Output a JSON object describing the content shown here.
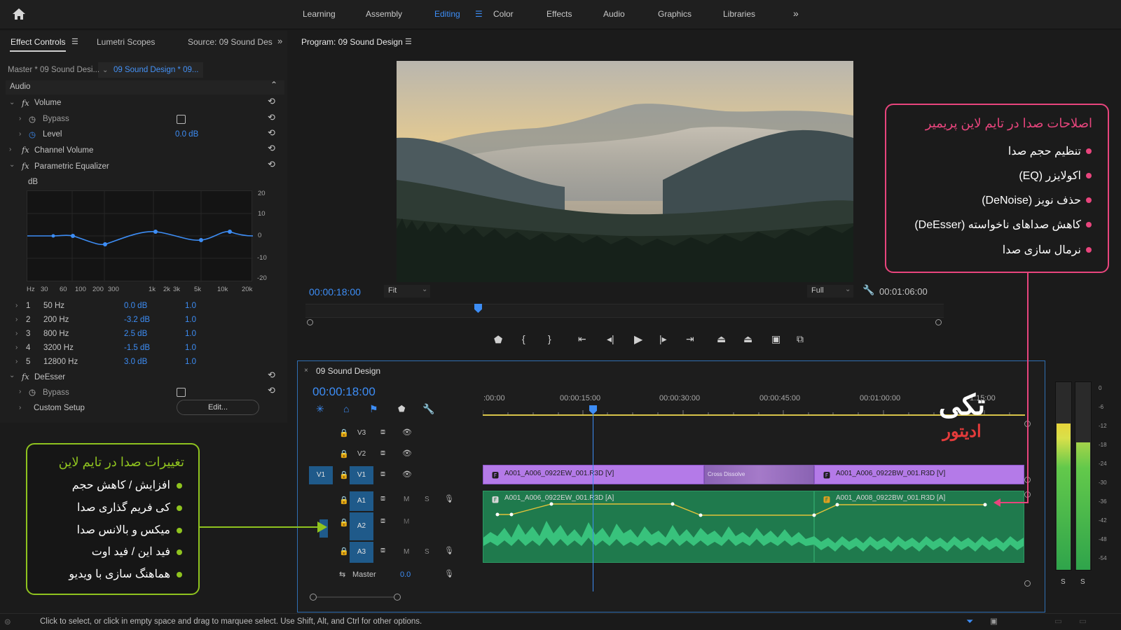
{
  "topbar": {
    "tabs": [
      "Learning",
      "Assembly",
      "Editing",
      "Color",
      "Effects",
      "Audio",
      "Graphics",
      "Libraries"
    ],
    "active_tab": "Editing"
  },
  "left_panel": {
    "tabs": [
      "Effect Controls",
      "Lumetri Scopes",
      "Source: 09 Sound Des"
    ],
    "master_label": "Master * 09 Sound Desi...",
    "sequence_label": "09 Sound Design * 09...",
    "section": "Audio",
    "volume": "Volume",
    "bypass": "Bypass",
    "level": "Level",
    "level_value": "0.0 dB",
    "channel_volume": "Channel Volume",
    "parametric_eq": "Parametric Equalizer",
    "db_label": "dB",
    "eq_y_ticks": [
      "20",
      "10",
      "0",
      "-10",
      "-20"
    ],
    "eq_x_ticks": [
      "Hz",
      "30",
      "60",
      "100",
      "200",
      "300",
      "1k",
      "2k",
      "3k",
      "5k",
      "10k",
      "20k"
    ],
    "bands": [
      {
        "n": "1",
        "freq": "50 Hz",
        "gain": "0.0 dB",
        "q": "1.0"
      },
      {
        "n": "2",
        "freq": "200 Hz",
        "gain": "-3.2 dB",
        "q": "1.0"
      },
      {
        "n": "3",
        "freq": "800 Hz",
        "gain": "2.5 dB",
        "q": "1.0"
      },
      {
        "n": "4",
        "freq": "3200 Hz",
        "gain": "-1.5 dB",
        "q": "1.0"
      },
      {
        "n": "5",
        "freq": "12800 Hz",
        "gain": "3.0 dB",
        "q": "1.0"
      }
    ],
    "deesser": "DeEsser",
    "deesser_bypass": "Bypass",
    "custom_setup": "Custom Setup",
    "edit_button": "Edit..."
  },
  "program": {
    "title": "Program: 09 Sound Design",
    "timecode": "00:00:18:00",
    "fit": "Fit",
    "full": "Full",
    "duration": "00:01:06:00",
    "playhead_fraction": 0.27
  },
  "timeline": {
    "title": "09 Sound Design",
    "timecode": "00:00:18:00",
    "ruler": [
      ":00:00",
      "00:00:15:00",
      "00:00:30:00",
      "00:00:45:00",
      "00:01:00:00",
      "1:15:00"
    ],
    "tracks": {
      "v3": "V3",
      "v2": "V2",
      "v1": "V1",
      "v1_src": "V1",
      "a1": "A1",
      "a2": "A2",
      "a3": "A3",
      "m": "M",
      "s": "S",
      "master": "Master",
      "master_value": "0.0"
    },
    "clip_v1": "A001_A006_0922EW_001.R3D [V]",
    "clip_v2": "A001_A006_0922BW_001.R3D [V]",
    "clip_a1": "A001_A006_0922EW_001.R3D [A]",
    "clip_a2": "A001_A008_0922BW_001.R3D [A]",
    "transition": "Cross Dissolve"
  },
  "vu": {
    "ticks": [
      "0",
      "-6",
      "-12",
      "-18",
      "-24",
      "-30",
      "-36",
      "-42",
      "-48",
      "-54"
    ],
    "solo_left": "S",
    "solo_right": "S",
    "left_level": 0.78,
    "right_level": 0.68
  },
  "callout_right": {
    "title": "اصلاحات صدا در تایم لاین پریمیر",
    "items": [
      "تنظیم حجم صدا",
      "اکولایزر (EQ)",
      "حذف نویز (DeNoise)",
      "کاهش صداهای ناخواسته (DeEsser)",
      "نرمال سازی صدا"
    ],
    "color": "#e8457d"
  },
  "callout_left": {
    "title": "تغییرات صدا در تایم لاین",
    "items": [
      "افزایش / کاهش حجم",
      "کی فریم گذاری صدا",
      "میکس و بالانس صدا",
      "فید این / فید اوت",
      "هماهنگ سازی با ویدیو"
    ],
    "color": "#8fc31f"
  },
  "logo": {
    "line1": "تکی",
    "line2": "ادیتور"
  },
  "status_bar": {
    "text": "Click to select, or click in empty space and drag to marquee select. Use Shift, Alt, and Ctrl for other options."
  }
}
